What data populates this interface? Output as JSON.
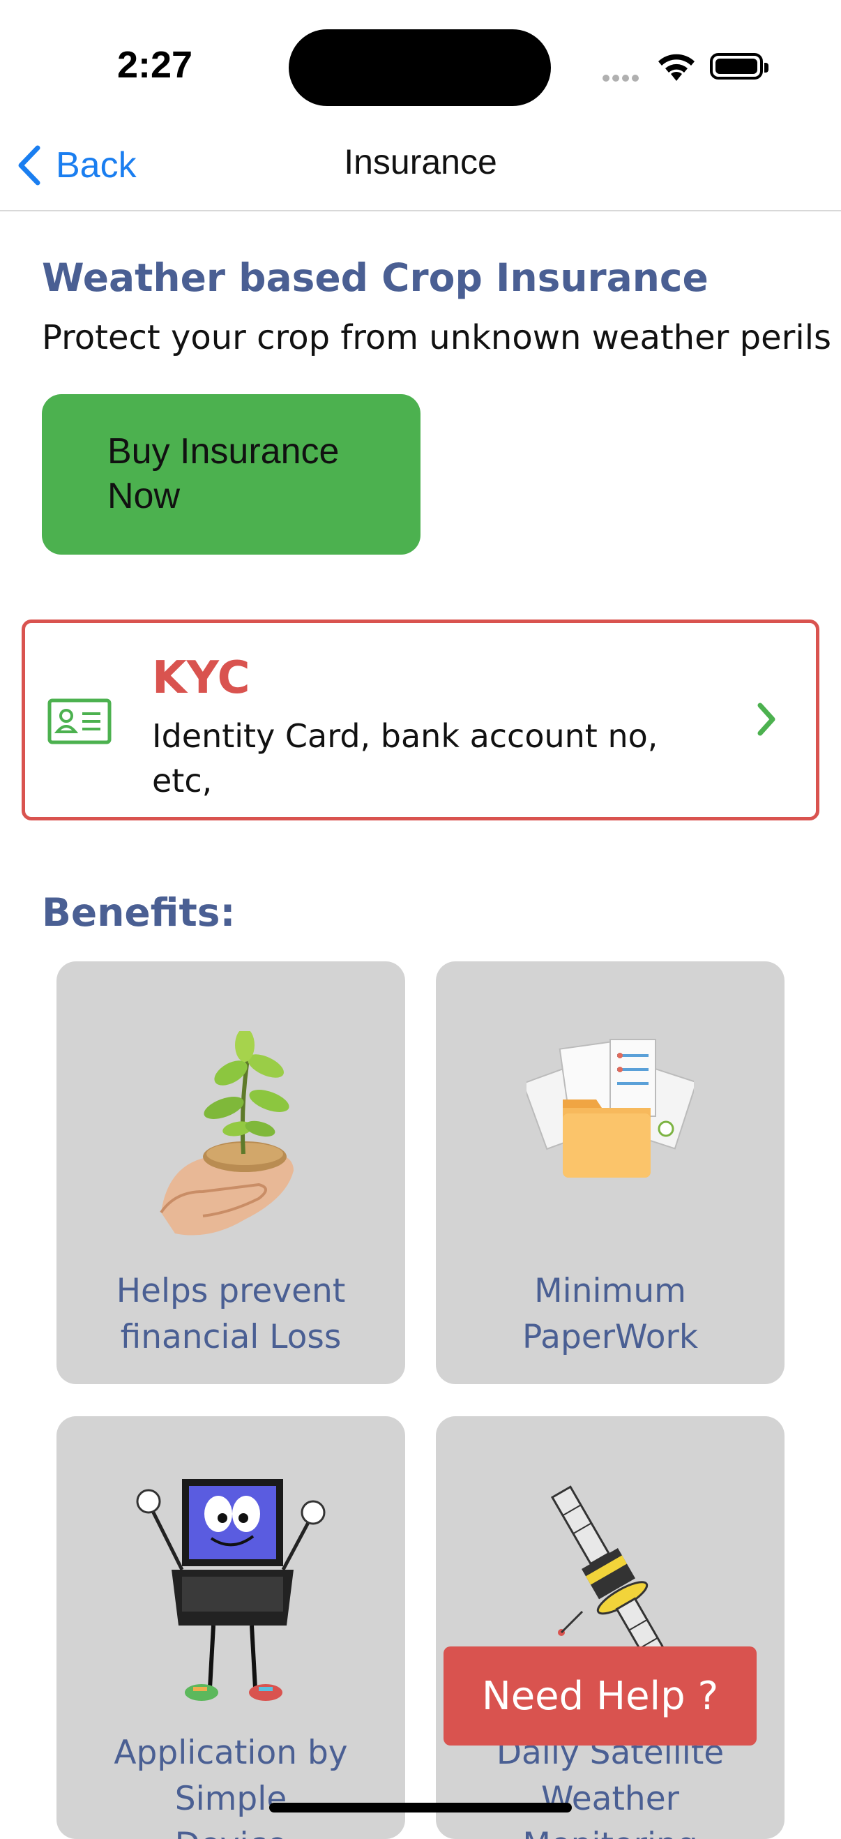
{
  "status": {
    "time": "2:27"
  },
  "nav": {
    "back_label": "Back",
    "title": "Insurance"
  },
  "hero": {
    "title": "Weather based Crop Insurance",
    "subtitle": "Protect your crop from unknown weather perils",
    "buy_button_line1": "Buy Insurance",
    "buy_button_line2": "Now"
  },
  "kyc": {
    "title": "KYC",
    "desc_line1": "Identity Card, bank account no,",
    "desc_line2": "etc,",
    "icon": "id-card-icon"
  },
  "benefits": {
    "title": "Benefits:",
    "items": [
      {
        "line1": "Helps prevent",
        "line2": "financial Loss",
        "icon": "plant-in-hand-image"
      },
      {
        "line1": "Minimum",
        "line2": "PaperWork",
        "icon": "documents-folder-image"
      },
      {
        "line1": "Application by",
        "line2": "Simple",
        "line3": "Device",
        "icon": "computer-character-image"
      },
      {
        "line1": "Daily Satellite",
        "line2": "Weather",
        "line3": "Monitoring",
        "icon": "satellite-image"
      }
    ]
  },
  "help": {
    "label": "Need Help ?"
  },
  "colors": {
    "accent_blue": "#1a7ef0",
    "title_blue": "#4a5f93",
    "buy_green": "#4cb14f",
    "kyc_red": "#d9534f",
    "tile_gray": "#d3d3d3"
  }
}
